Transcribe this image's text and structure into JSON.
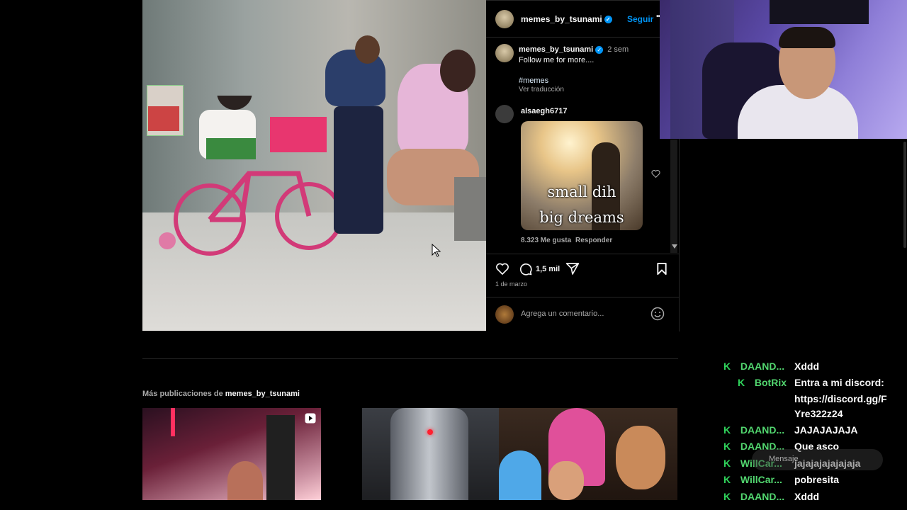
{
  "post": {
    "author": "memes_by_tsunami",
    "follow_label": "Seguir",
    "more_label": "•••",
    "caption_author": "memes_by_tsunami",
    "caption_time": "2 sem",
    "caption_text": "Follow me for more....",
    "hashtag": "#memes",
    "translate_label": "Ver traducción",
    "comment": {
      "author": "alsaegh6717",
      "image_text_line1": "small dih",
      "image_text_line2": "big dreams",
      "likes": "8.323 Me gusta",
      "reply_label": "Responder"
    },
    "comment_count": "1,5 mil",
    "date": "1 de marzo",
    "comment_placeholder": "Agrega un comentario..."
  },
  "more_posts": {
    "prefix": "Más publicaciones de",
    "author": "memes_by_tsunami"
  },
  "chat": [
    {
      "badge": "K",
      "name": "DAAND...",
      "message": "Xddd"
    },
    {
      "badge": "K",
      "name": "BotRix",
      "message": "Entra a mi discord:"
    },
    {
      "badge": "",
      "name": "",
      "message": "https://discord.gg/F"
    },
    {
      "badge": "",
      "name": "",
      "message": "Yre322z24"
    },
    {
      "badge": "K",
      "name": "DAAND...",
      "message": "JAJAJAJAJA"
    },
    {
      "badge": "K",
      "name": "DAAND...",
      "message": "Que asco"
    },
    {
      "badge": "K",
      "name": "WillCar...",
      "message": "jajajajajajajaja"
    },
    {
      "badge": "K",
      "name": "WillCar...",
      "message": "pobresita"
    },
    {
      "badge": "K",
      "name": "DAAND...",
      "message": "Xddd"
    }
  ],
  "chat_overlay": "Mensaje",
  "colors": {
    "verified": "#0095f6",
    "chat_name": "#52d66f",
    "bg": "#000000"
  }
}
